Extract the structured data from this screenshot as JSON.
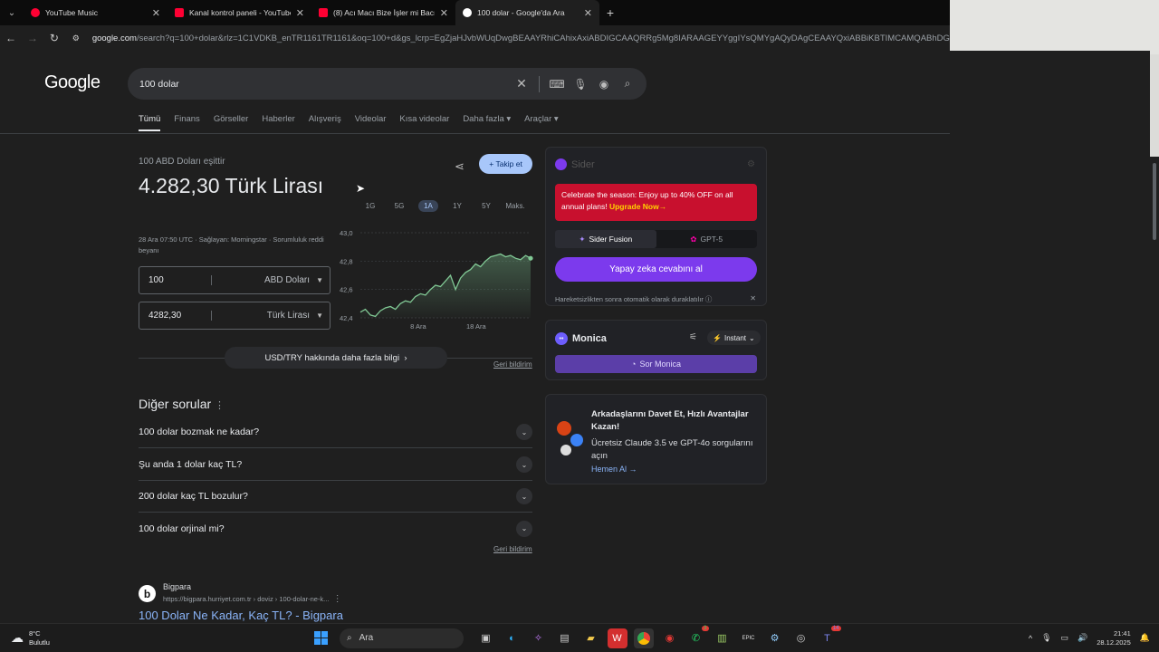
{
  "browser": {
    "tabs": [
      {
        "title": "YouTube Music",
        "color": "#ff0033",
        "active": false
      },
      {
        "title": "Kanal kontrol paneli - YouTube",
        "color": "#ff0033",
        "active": false
      },
      {
        "title": "(8) Acı Macı Bize İşler mi Bacı Y...",
        "color": "#ff0033",
        "active": false
      },
      {
        "title": "100 dolar - Google'da Ara",
        "color": "#ffffff",
        "active": true
      }
    ],
    "url_host": "google.com",
    "url_rest": "/search?q=100+dolar&rlz=1C1VDKB_enTR1161TR1161&oq=100+d&gs_lcrp=EgZjaHJvbWUqDwgBEAAYRhiCAhixAxiABDIGCAAQRRg5Mg8IARAAGEYYggIYsQMYgAQyDAgCEAAYQxiABBiKBTIMCAMQABhDGIAEGIoFMgwI"
  },
  "google": {
    "logo": "Google",
    "query": "100 dolar",
    "tabs": [
      "Tümü",
      "Finans",
      "Görseller",
      "Haberler",
      "Alışveriş",
      "Videolar",
      "Kısa videolar",
      "Daha fazla",
      "Araçlar"
    ]
  },
  "converter": {
    "lead": "100 ABD Doları eşittir",
    "result": "4.282,30 Türk Lirası",
    "meta": "28 Ara 07:50 UTC · Sağlayan: Morningstar · Sorumluluk reddi beyanı",
    "follow": "Takip et",
    "from_value": "100",
    "from_unit": "ABD Doları",
    "to_value": "4282,30",
    "to_unit": "Türk Lirası",
    "more": "USD/TRY hakkında daha fazla bilgi",
    "feedback": "Geri bildirim",
    "ranges": [
      "1G",
      "5G",
      "1A",
      "1Y",
      "5Y",
      "Maks."
    ],
    "selected_range": "1A"
  },
  "chart_data": {
    "type": "area",
    "y_ticks": [
      "43,0",
      "42,8",
      "42,6",
      "42,4"
    ],
    "ylim": [
      42.4,
      43.0
    ],
    "x_ticks": [
      "8 Ara",
      "18 Ara"
    ],
    "values": [
      42.44,
      42.46,
      42.42,
      42.41,
      42.45,
      42.47,
      42.48,
      42.46,
      42.5,
      42.52,
      42.51,
      42.55,
      42.57,
      42.56,
      42.6,
      42.63,
      42.62,
      42.66,
      42.7,
      42.6,
      42.68,
      42.72,
      42.74,
      42.78,
      42.76,
      42.8,
      42.83,
      42.84,
      42.85,
      42.83,
      42.84,
      42.82,
      42.81,
      42.84,
      42.82
    ],
    "color": "#81c995"
  },
  "paa": {
    "title": "Diğer sorular",
    "questions": [
      "100 dolar bozmak ne kadar?",
      "Şu anda 1 dolar kaç TL?",
      "200 dolar kaç TL bozulur?",
      "100 dolar orjinal mi?"
    ],
    "feedback": "Geri bildirim"
  },
  "result": {
    "favicon": "b",
    "site": "Bigpara",
    "cite": "https://bigpara.hurriyet.com.tr › doviz › 100-dolar-ne-k...",
    "title": "100 Dolar Ne Kadar, Kaç TL? - Bigpara"
  },
  "sider": {
    "name": "Sider",
    "promo_text": "Celebrate the season: Enjoy up to 40% OFF on all annual plans!",
    "promo_link": "Upgrade Now→",
    "model_a": "Sider Fusion",
    "model_b": "GPT-5",
    "ask": "Yapay zeka cevabını al",
    "hint": "Hareketsizlikten sonra otomatik olarak duraklatılır"
  },
  "monica": {
    "name": "Monica",
    "mode": "Instant",
    "ask": "Sor Monica"
  },
  "invite": {
    "title": "Arkadaşlarını Davet Et, Hızlı Avantajlar Kazan!",
    "body": "Ücretsiz Claude 3.5 ve GPT-4o sorgularını açın",
    "link": "Hemen Al"
  },
  "taskbar": {
    "weather_temp": "8°C",
    "weather_desc": "Bulutlu",
    "search": "Ara",
    "time": "21:41",
    "date": "28.12.2025",
    "badge_whatsapp": "3",
    "badge_teams": "14"
  }
}
